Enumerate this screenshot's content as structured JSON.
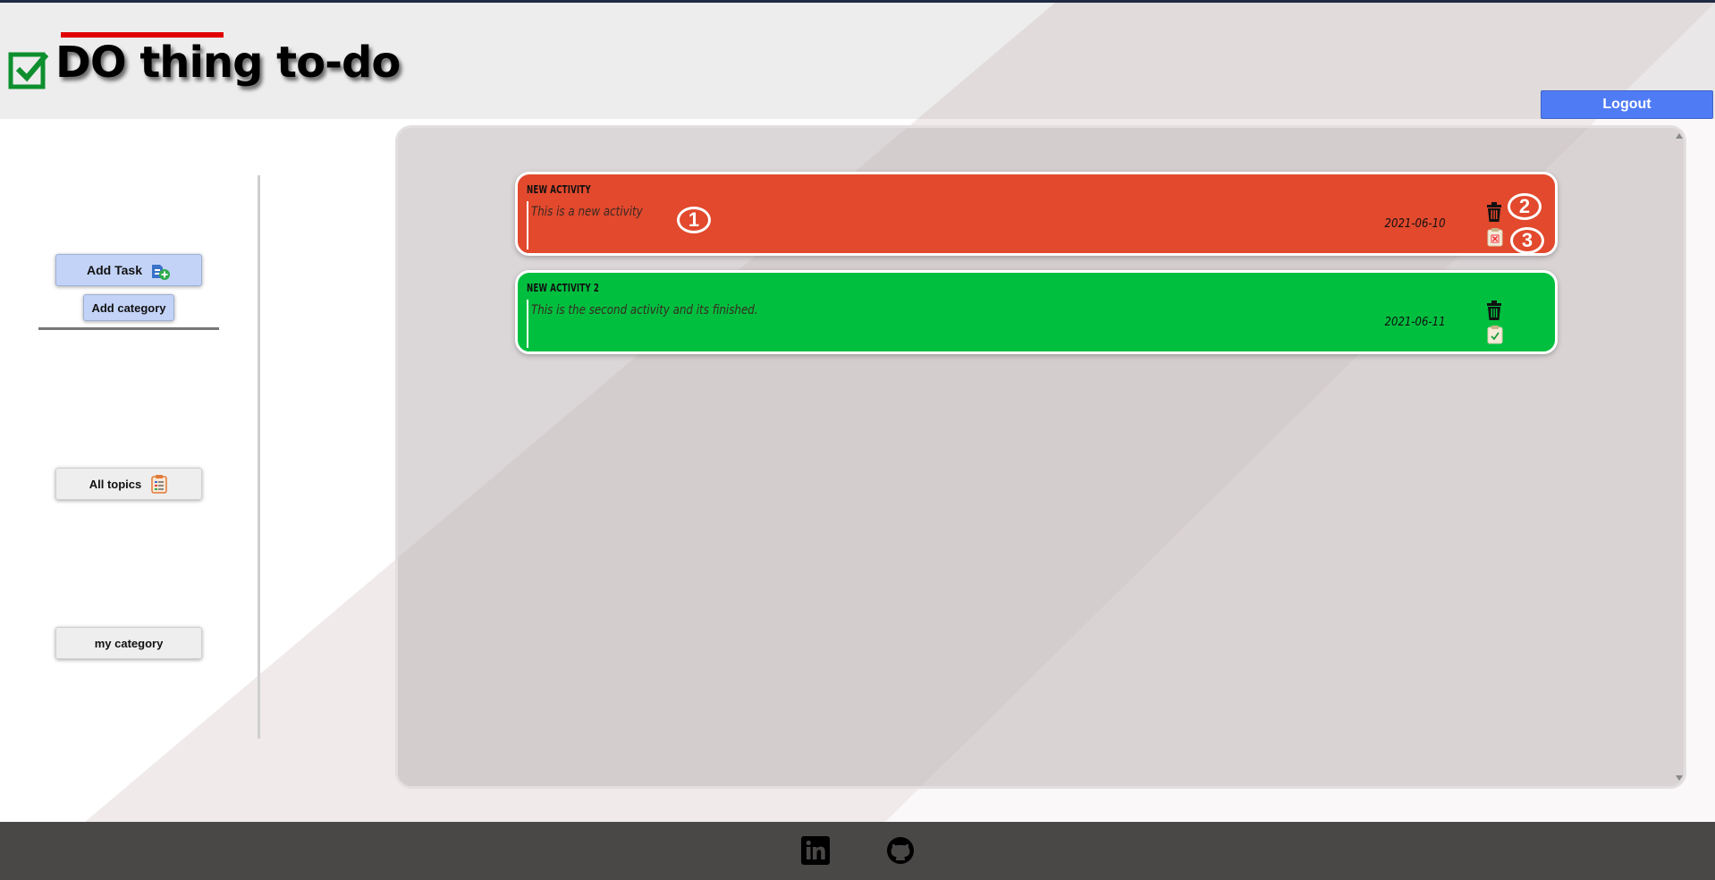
{
  "header": {
    "title": "DO thing to-do",
    "logout_label": "Logout"
  },
  "sidebar": {
    "add_task_label": "Add Task",
    "add_category_label": "Add category",
    "all_topics_label": "All topics",
    "categories": [
      "my category"
    ]
  },
  "tasks": [
    {
      "title": "NEW ACTIVITY",
      "description": "This is a new activity",
      "date": "2021-06-10",
      "status": "pending",
      "color": "#e2492d"
    },
    {
      "title": "NEW ACTIVITY 2",
      "description": "This is the second activity and its finished.",
      "date": "2021-06-11",
      "status": "finished",
      "color": "#00bf3f"
    }
  ],
  "callouts": [
    "1",
    "2",
    "3"
  ],
  "footer": {
    "icons": [
      "linkedin-icon",
      "github-icon"
    ]
  },
  "colors": {
    "accent": "#4f7cf5",
    "task_pending": "#e2492d",
    "task_done": "#00bf3f",
    "footer": "#4a4847"
  }
}
